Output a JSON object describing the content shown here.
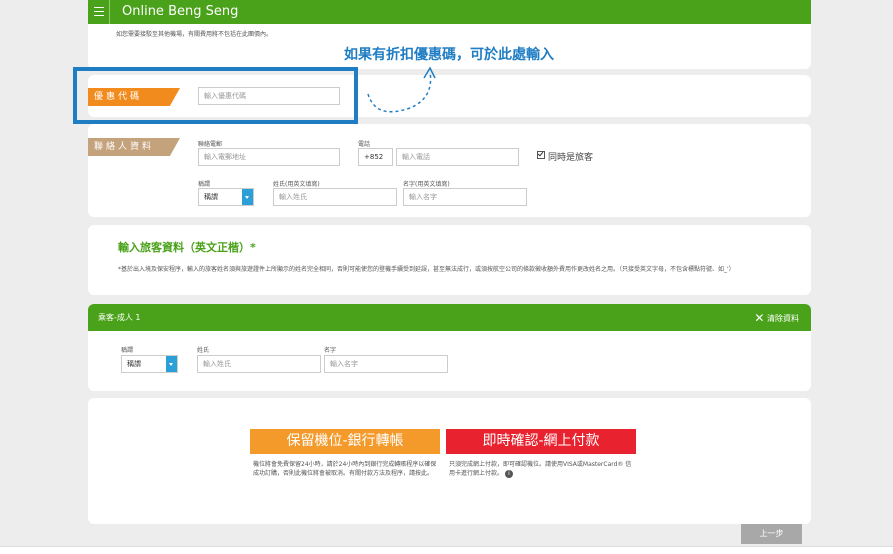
{
  "app": {
    "title": "Online Beng Seng"
  },
  "notice": {
    "line1": "如您需要接駁至其他機場，有關費用將不包括在此團價內。"
  },
  "annotation": {
    "text": "如果有折扣優惠碼，可於此處輸入"
  },
  "promo": {
    "tag": "優惠代碼",
    "placeholder": "輸入優惠代碼"
  },
  "contact": {
    "tag": "聯絡人資料",
    "email_label": "聯絡電郵",
    "email_placeholder": "輸入電郵地址",
    "phone_label": "電話",
    "phone_code": "+852",
    "phone_placeholder": "輸入電話",
    "same_as_traveler": "同時是旅客",
    "title_label": "稱謂",
    "title_value": "稱謂",
    "surname_label": "姓氏(用英文填寫)",
    "surname_placeholder": "輸入姓氏",
    "given_label": "名字(用英文填寫)",
    "given_placeholder": "輸入名字"
  },
  "traveler_info": {
    "title": "輸入旅客資料（英文正楷）*",
    "note": "*基於出入境及保安程序，輸入的旅客姓名須與旅遊證件上所顯示的姓名完全相同，否則可能使您的登機手續受到延誤，甚至無法成行，或須按航空公司的條款徵收額外費用作更改姓名之用。（只接受英文字母，不包含標點符號、如_'）"
  },
  "passenger": {
    "header": "乘客-成人 1",
    "clear": "清除資料",
    "title_label": "稱謂",
    "title_value": "稱謂",
    "surname_label": "姓氏",
    "surname_placeholder": "輸入姓氏",
    "given_label": "名字",
    "given_placeholder": "輸入名字"
  },
  "payment": {
    "reserve_label": "保留機位-銀行轉帳",
    "reserve_desc": "機位將會免費保留24小時，請於24小時內到銀行完成轉賬程序以確保成功訂購，否則此機位將會被取消。有關付款方法及程序，請按此。",
    "instant_label": "即時確認-網上付款",
    "instant_desc": "只須完成網上付款，即可確認機位。請使用VISA或MasterCard® 信用卡進行網上付款。",
    "colors": {
      "reserve": "#f39a2b",
      "instant": "#e8222e"
    }
  },
  "nav": {
    "back": "上一步"
  },
  "colors": {
    "brand_green": "#4aa21a",
    "highlight_blue": "#1f7dc4"
  }
}
